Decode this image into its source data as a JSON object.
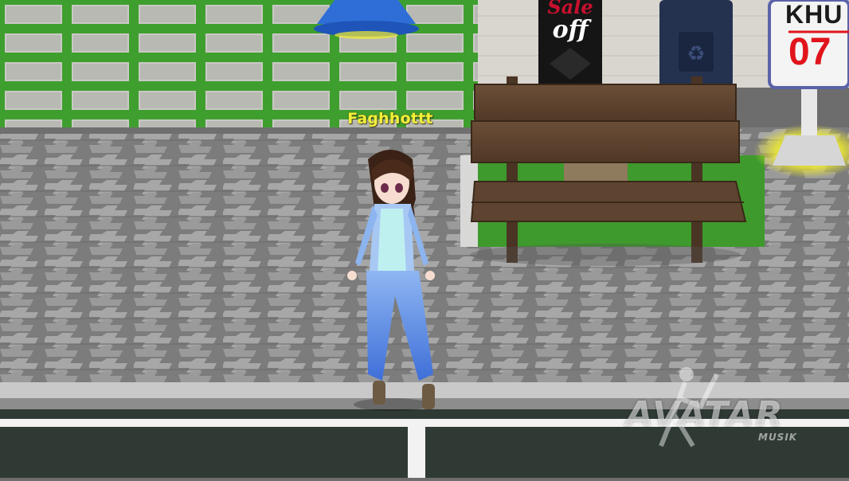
{
  "player": {
    "name": "Faghhottt"
  },
  "shop_banner": {
    "line1": "Sale",
    "line2": "off"
  },
  "street_sign": {
    "top": "KHU",
    "number": "07"
  },
  "watermark": {
    "title": "AVATAR",
    "subtitle": "MUSIK"
  },
  "colors": {
    "nametag": "#f1f03a",
    "grass": "#3a9a2a",
    "paving": "#8a8a8a",
    "bench": "#5c4330",
    "outfit": "#6f9be8"
  }
}
